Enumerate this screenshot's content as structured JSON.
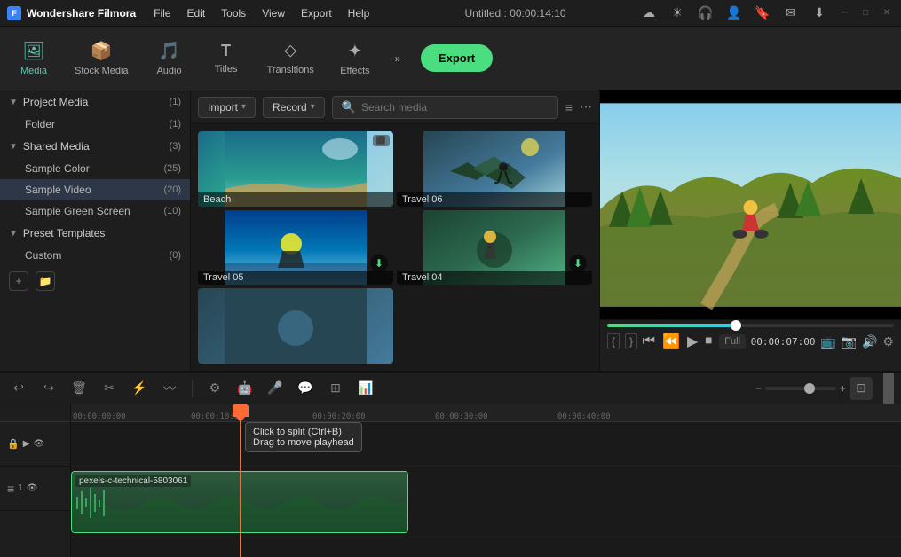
{
  "app": {
    "name": "Wondershare Filmora",
    "title": "Untitled : 00:00:14:10"
  },
  "menu": {
    "items": [
      "File",
      "Edit",
      "Tools",
      "View",
      "Export",
      "Help"
    ]
  },
  "toolbar": {
    "buttons": [
      {
        "id": "media",
        "label": "Media",
        "icon": "🖼"
      },
      {
        "id": "stock-media",
        "label": "Stock Media",
        "icon": "📦"
      },
      {
        "id": "audio",
        "label": "Audio",
        "icon": "🎵"
      },
      {
        "id": "titles",
        "label": "Titles",
        "icon": "T"
      },
      {
        "id": "transitions",
        "label": "Transitions",
        "icon": "⬦"
      },
      {
        "id": "effects",
        "label": "Effects",
        "icon": "✦"
      }
    ],
    "export_label": "Export"
  },
  "left_panel": {
    "project_media": {
      "title": "Project Media",
      "count": "(1)",
      "items": [
        {
          "label": "Folder",
          "count": "(1)"
        }
      ]
    },
    "shared_media": {
      "title": "Shared Media",
      "count": "(3)"
    },
    "sample_color": {
      "label": "Sample Color",
      "count": "(25)"
    },
    "sample_video": {
      "label": "Sample Video",
      "count": "(20)"
    },
    "sample_green": {
      "label": "Sample Green Screen",
      "count": "(10)"
    },
    "preset_templates": {
      "title": "Preset Templates",
      "count": ""
    },
    "custom": {
      "label": "Custom",
      "count": "(0)"
    }
  },
  "media_toolbar": {
    "import_label": "Import",
    "record_label": "Record",
    "search_placeholder": "Search media"
  },
  "media_items": [
    {
      "id": "beach",
      "label": "Beach",
      "has_download": false
    },
    {
      "id": "travel06",
      "label": "Travel 06",
      "has_download": false
    },
    {
      "id": "travel05",
      "label": "Travel 05",
      "has_download": true
    },
    {
      "id": "travel04",
      "label": "Travel 04",
      "has_download": true
    },
    {
      "id": "partial1",
      "label": "",
      "has_download": false
    }
  ],
  "preview": {
    "timecode_start": "{",
    "timecode_end": "}",
    "timecode": "00:00:07:00",
    "fullscreen_label": "Full"
  },
  "timeline": {
    "ruler_marks": [
      "00:00:00:00",
      "00:00:10:00",
      "00:00:20:00",
      "00:00:30:00",
      "00:00:40:00"
    ],
    "clip_label": "pexels-c-technical-5803061",
    "tooltip_line1": "Click to split (Ctrl+B)",
    "tooltip_line2": "Drag to move playhead",
    "track_icons": [
      "🔒",
      ""
    ]
  }
}
